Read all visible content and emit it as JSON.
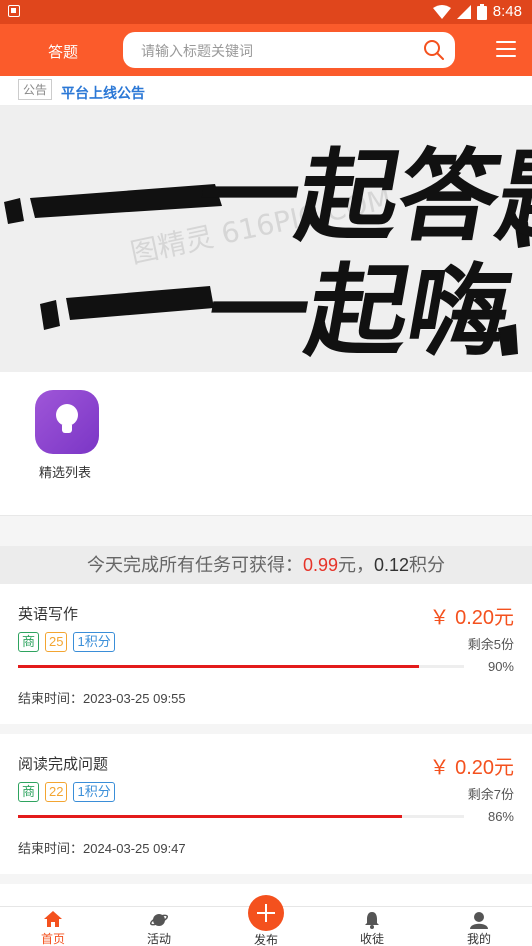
{
  "status_bar": {
    "time": "8:48",
    "battery": "8"
  },
  "header": {
    "title": "答题",
    "search_placeholder": "请输入标题关键词"
  },
  "notice": {
    "tag": "公告",
    "text": "平台上线公告"
  },
  "banner": {
    "line1": "一起答题",
    "line2": "一起嗨",
    "watermark": "图精灵 616PIC.COM"
  },
  "features": [
    {
      "label": "精选列表",
      "icon": "lightbulb-icon"
    }
  ],
  "summary": {
    "prefix": "今天完成所有任务可获得：",
    "money": "0.99",
    "money_unit": "元",
    "sep": "，",
    "points": "0.12",
    "points_unit": "积分"
  },
  "tasks": [
    {
      "name": "英语写作",
      "price": "￥ 0.20元",
      "tag_type": "商",
      "tag_count": "25",
      "tag_points": "1积分",
      "remaining": "剩余5份",
      "progress_pct": 90,
      "progress_label": "90%",
      "end_time": "结束时间：2023-03-25 09:55"
    },
    {
      "name": "阅读完成问题",
      "price": "￥ 0.20元",
      "tag_type": "商",
      "tag_count": "22",
      "tag_points": "1积分",
      "remaining": "剩余7份",
      "progress_pct": 86,
      "progress_label": "86%",
      "end_time": "结束时间：2024-03-25 09:47"
    }
  ],
  "tabs": [
    {
      "label": "首页",
      "icon": "home-icon",
      "active": true
    },
    {
      "label": "活动",
      "icon": "planet-icon",
      "active": false
    },
    {
      "label": "发布",
      "icon": "plus-icon",
      "active": false
    },
    {
      "label": "收徒",
      "icon": "bell-icon",
      "active": false
    },
    {
      "label": "我的",
      "icon": "user-icon",
      "active": false
    }
  ],
  "colors": {
    "primary": "#fb5b2b",
    "accent": "#f4511e",
    "link": "#2b78d6",
    "progress": "#e31b1b"
  }
}
